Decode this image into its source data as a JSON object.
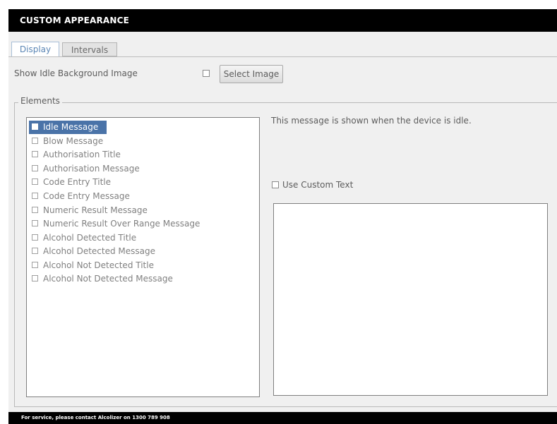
{
  "window": {
    "title": "CUSTOM APPEARANCE"
  },
  "tabs": [
    {
      "label": "Display",
      "active": true
    },
    {
      "label": "Intervals",
      "active": false
    }
  ],
  "idle_background": {
    "label": "Show Idle Background Image",
    "checked": false,
    "button_label": "Select Image"
  },
  "elements": {
    "legend": "Elements",
    "selected_index": 0,
    "items": [
      {
        "label": "Idle Message"
      },
      {
        "label": "Blow Message"
      },
      {
        "label": "Authorisation Title"
      },
      {
        "label": "Authorisation Message"
      },
      {
        "label": "Code Entry Title"
      },
      {
        "label": "Code Entry Message"
      },
      {
        "label": "Numeric Result Message"
      },
      {
        "label": "Numeric Result Over Range Message"
      },
      {
        "label": "Alcohol Detected Title"
      },
      {
        "label": "Alcohol Detected Message"
      },
      {
        "label": "Alcohol Not Detected Title"
      },
      {
        "label": "Alcohol Not Detected Message"
      }
    ]
  },
  "detail": {
    "description": "This message is shown when the device is idle.",
    "use_custom_text_label": "Use Custom Text",
    "use_custom_text_checked": false,
    "custom_text_value": ""
  },
  "footer": {
    "text": "For service, please contact Alcolizer on 1300 789 908"
  },
  "colors": {
    "selection": "#4a73a8",
    "title_bar": "#000000",
    "active_tab_text": "#5b86b5"
  }
}
